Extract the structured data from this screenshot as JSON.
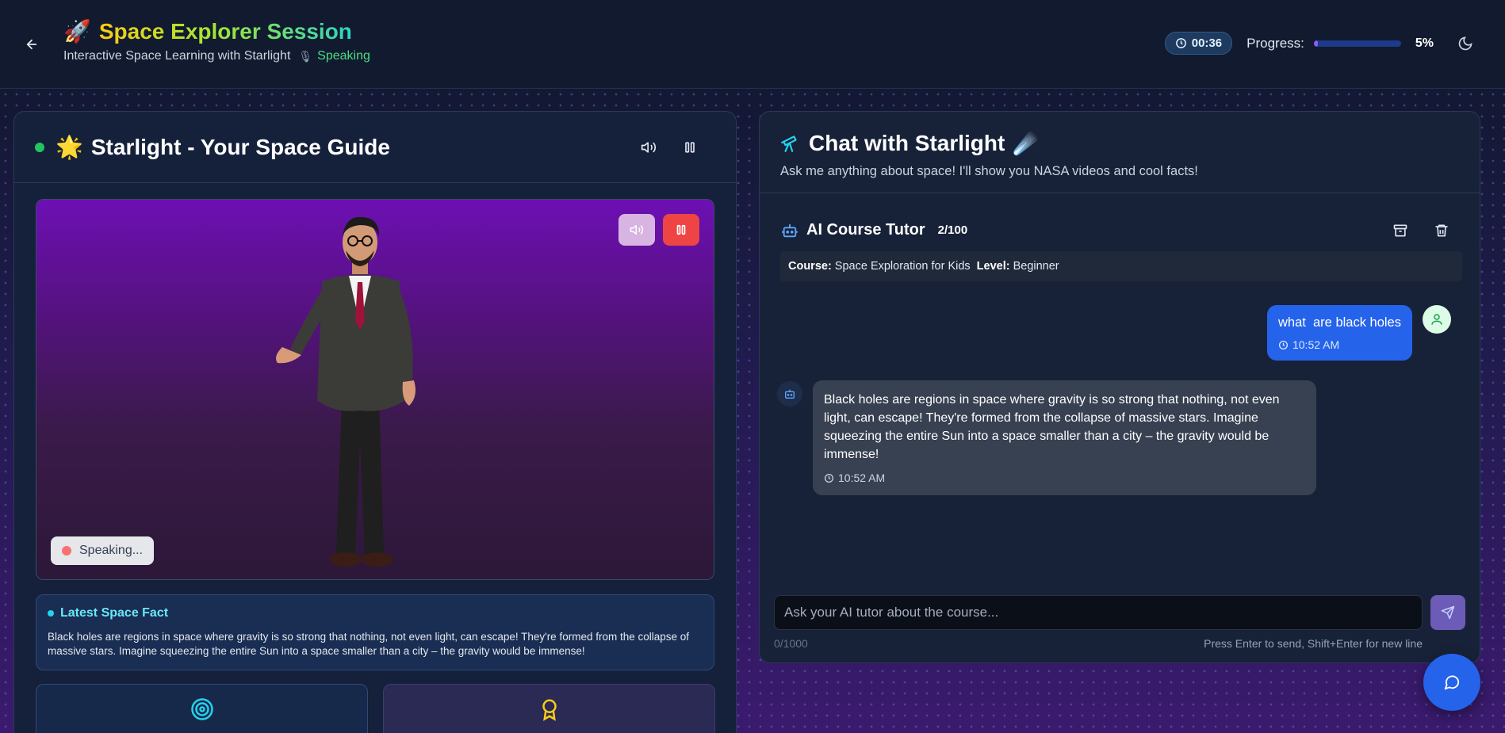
{
  "header": {
    "title": "Space Explorer Session",
    "subtitle": "Interactive Space Learning with Starlight",
    "status": "Speaking",
    "timer": "00:36",
    "progress_label": "Progress:",
    "progress_value": "5%",
    "progress_fraction": 0.05
  },
  "guide_panel": {
    "title": "Starlight - Your Space Guide",
    "speaking_label": "Speaking...",
    "fact_title": "Latest Space Fact",
    "fact_text": "Black holes are regions in space where gravity is so strong that nothing, not even light, can escape! They're formed from the collapse of massive stars. Imagine squeezing the entire Sun into a space smaller than a city – the gravity would be immense!"
  },
  "chat_panel": {
    "title": "Chat with Starlight",
    "subtitle": "Ask me anything about space! I'll show you NASA videos and cool facts!",
    "tutor_name": "AI Course Tutor",
    "tutor_count": "2/100",
    "course_label": "Course:",
    "course_value": "Space Exploration for Kids",
    "level_label": "Level:",
    "level_value": "Beginner",
    "messages": [
      {
        "role": "user",
        "text": "what  are black holes",
        "time": "10:52 AM"
      },
      {
        "role": "assistant",
        "text": "Black holes are regions in space where gravity is so strong that nothing, not even light, can escape! They're formed from the collapse of massive stars. Imagine squeezing the entire Sun into a space smaller than a city – the gravity would be immense!",
        "time": "10:52 AM"
      }
    ],
    "input_placeholder": "Ask your AI tutor about the course...",
    "char_count": "0/1000",
    "enter_hint": "Press Enter to send, Shift+Enter for new line"
  },
  "colors": {
    "accent_blue": "#2563eb",
    "speaking_green": "#4ade80",
    "pause_red": "#ef4444",
    "fact_cyan": "#67e8f9"
  }
}
